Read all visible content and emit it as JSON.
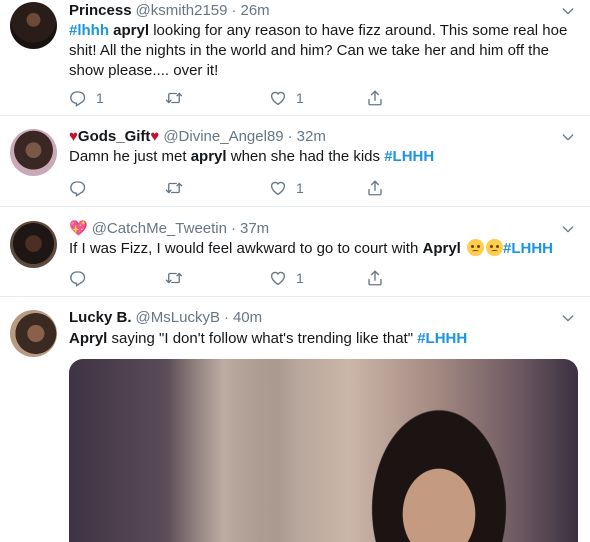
{
  "tweets": [
    {
      "display_name": "Princess",
      "handle": "@ksmith2159",
      "time": "26m",
      "text_parts": [
        "#lhhh",
        " ",
        "apryl",
        " looking for any reason to have fizz around. This some real hoe shit! All the nights in the world and him? Can we take her and him off the show please.... over it!"
      ],
      "replies": "1",
      "retweets": "",
      "likes": "1"
    },
    {
      "display_name": "Gods_Gift",
      "handle": "@Divine_Angel89",
      "time": "32m",
      "text_parts": [
        "Damn he just met ",
        "apryl",
        " when she had the kids ",
        "#LHHH"
      ],
      "replies": "",
      "retweets": "",
      "likes": "1"
    },
    {
      "display_name": "",
      "handle": "@CatchMe_Tweetin",
      "time": "37m",
      "text_parts": [
        "If I was Fizz, I would feel awkward to go to court with ",
        "Apryl",
        " ",
        "#LHHH"
      ],
      "replies": "",
      "retweets": "",
      "likes": "1"
    },
    {
      "display_name": "Lucky B.",
      "handle": "@MsLuckyB",
      "time": "40m",
      "text_parts": [
        "Apryl",
        " saying \"I don't follow what's trending like that\" ",
        "#LHHH"
      ]
    }
  ],
  "colors": {
    "accent": "#1b95e0",
    "text": "#14171a",
    "muted": "#657786",
    "divider": "#e6ecf0",
    "heart": "#c8102e"
  },
  "icons": [
    "reply-icon",
    "retweet-icon",
    "like-icon",
    "share-icon",
    "chevron-down-icon",
    "red-heart-emoji",
    "sparkling-heart-emoji",
    "pleading-face-emoji"
  ]
}
